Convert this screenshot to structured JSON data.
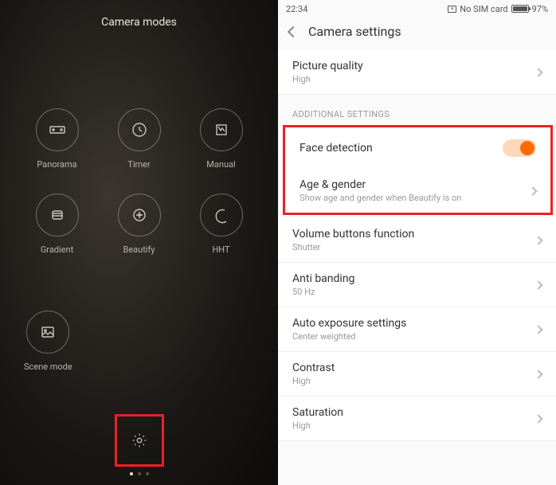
{
  "left": {
    "title": "Camera modes",
    "modes": [
      {
        "label": "Panorama",
        "icon": "panorama-icon"
      },
      {
        "label": "Timer",
        "icon": "timer-icon"
      },
      {
        "label": "Manual",
        "icon": "manual-icon"
      },
      {
        "label": "Gradient",
        "icon": "gradient-icon"
      },
      {
        "label": "Beautify",
        "icon": "beautify-icon"
      },
      {
        "label": "HHT",
        "icon": "hht-icon"
      },
      {
        "label": "Scene mode",
        "icon": "scene-icon"
      }
    ],
    "settings_icon": "gear-icon",
    "page_indicator": {
      "count": 3,
      "active": 0
    }
  },
  "right": {
    "status": {
      "time": "22:34",
      "sim": "No SIM card",
      "battery_pct": "97%"
    },
    "header": {
      "title": "Camera settings"
    },
    "rows": [
      {
        "title": "Picture quality",
        "sub": "High",
        "type": "nav"
      },
      {
        "group": "ADDITIONAL SETTINGS"
      },
      {
        "title": "Face detection",
        "type": "toggle",
        "on": true
      },
      {
        "title": "Age & gender",
        "sub": "Show age and gender when Beautify is on",
        "type": "nav"
      },
      {
        "title": "Volume buttons function",
        "sub": "Shutter",
        "type": "nav"
      },
      {
        "title": "Anti banding",
        "sub": "50 Hz",
        "type": "nav"
      },
      {
        "title": "Auto exposure settings",
        "sub": "Center weighted",
        "type": "nav"
      },
      {
        "title": "Contrast",
        "sub": "High",
        "type": "nav"
      },
      {
        "title": "Saturation",
        "sub": "High",
        "type": "nav"
      }
    ],
    "highlight_rows": [
      "Face detection",
      "Age & gender"
    ],
    "colors": {
      "accent": "#ff6b00",
      "highlight": "#ed2024"
    }
  }
}
